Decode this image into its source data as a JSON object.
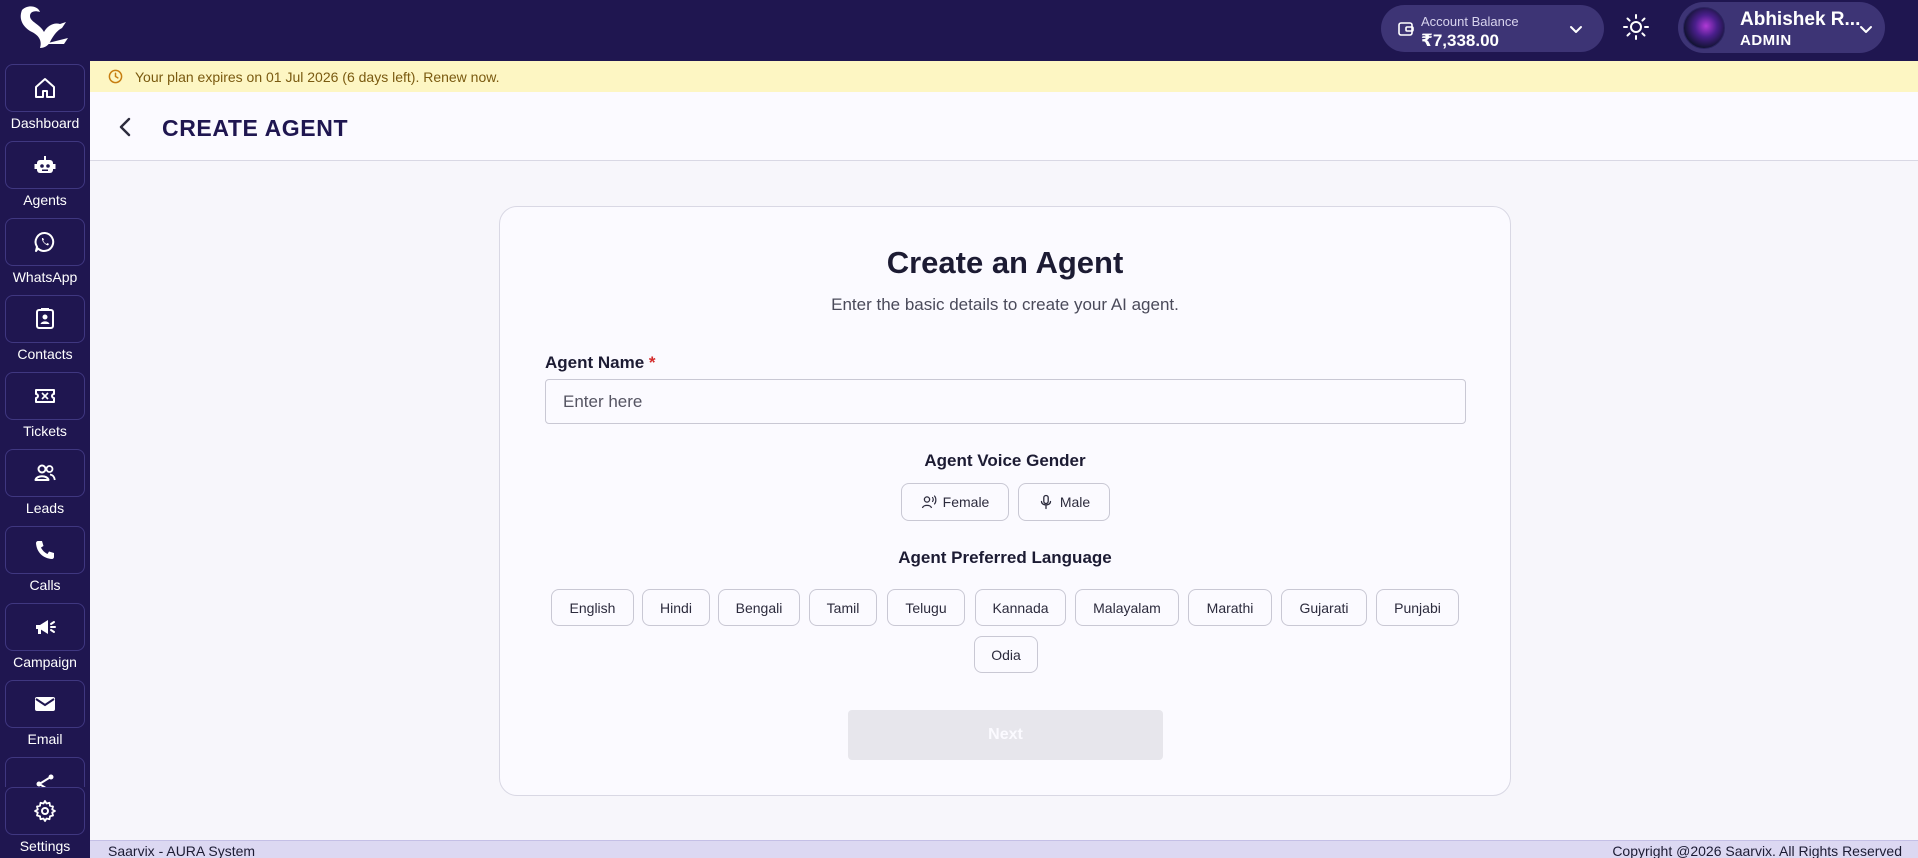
{
  "header": {
    "balance_label": "Account Balance",
    "balance_amount": "₹7,338.00",
    "user_name": "Abhishek R...",
    "user_role": "ADMIN"
  },
  "sidebar": {
    "items": [
      {
        "label": "Dashboard",
        "icon": "home-icon"
      },
      {
        "label": "Agents",
        "icon": "robot-icon"
      },
      {
        "label": "WhatsApp",
        "icon": "whatsapp-icon"
      },
      {
        "label": "Contacts",
        "icon": "contact-card-icon"
      },
      {
        "label": "Tickets",
        "icon": "ticket-icon"
      },
      {
        "label": "Leads",
        "icon": "users-icon"
      },
      {
        "label": "Calls",
        "icon": "phone-icon"
      },
      {
        "label": "Campaign",
        "icon": "megaphone-icon"
      },
      {
        "label": "Email",
        "icon": "mail-icon"
      },
      {
        "label": "",
        "icon": "share-icon"
      },
      {
        "label": "Settings",
        "icon": "gear-icon"
      }
    ]
  },
  "banner": {
    "text": "Your plan expires on 01 Jul 2026 (6 days left). Renew now."
  },
  "page": {
    "title": "CREATE AGENT"
  },
  "form": {
    "heading": "Create an Agent",
    "subheading": "Enter the basic details to create your AI agent.",
    "name_label": "Agent Name",
    "required_mark": "*",
    "name_placeholder": "Enter here",
    "name_value": "",
    "gender_label": "Agent Voice Gender",
    "gender_options": [
      "Female",
      "Male"
    ],
    "language_label": "Agent Preferred Language",
    "languages": [
      "English",
      "Hindi",
      "Bengali",
      "Tamil",
      "Telugu",
      "Kannada",
      "Malayalam",
      "Marathi",
      "Gujarati",
      "Punjabi",
      "Odia"
    ],
    "next_label": "Next"
  },
  "footer": {
    "left": "Saarvix - AURA System",
    "right": "Copyright @2026 Saarvix. All Rights Reserved"
  },
  "colors": {
    "nav_bg": "#1f1650",
    "banner_bg": "#fdf6c3",
    "accent": "#3d3475",
    "required": "#d42a2a"
  }
}
